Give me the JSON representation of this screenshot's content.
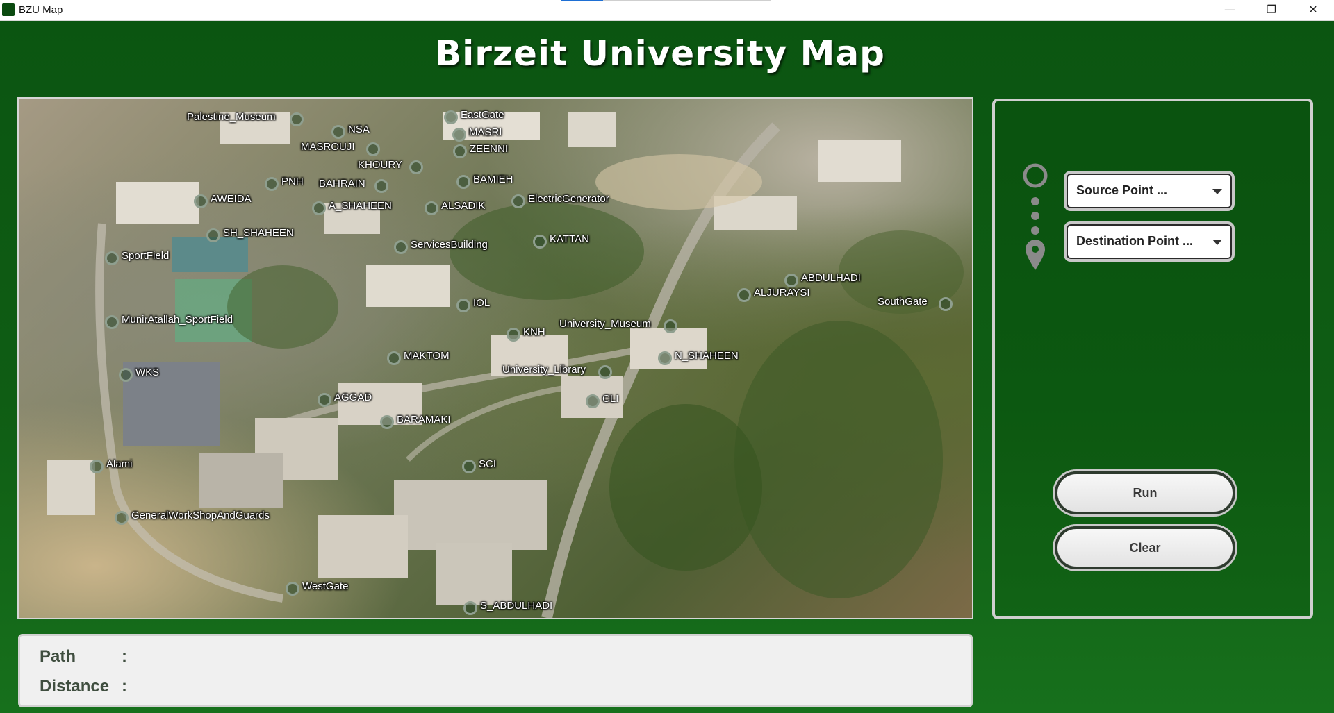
{
  "window": {
    "title": "BZU Map",
    "icon": "tree-icon",
    "controls": [
      "minimize-icon",
      "maximize-icon",
      "close-icon"
    ]
  },
  "app": {
    "title": "Birzeit University Map"
  },
  "map": {
    "image": "aerial-campus-photo",
    "locations": [
      "Palestine_Museum",
      "NSA",
      "EastGate",
      "MASRI",
      "MASROUJI",
      "ZEENNI",
      "KHOURY",
      "PNH",
      "BAHRAIN",
      "BAMIEH",
      "AWEIDA",
      "A_SHAHEEN",
      "ALSADIK",
      "ElectricGenerator",
      "SH_SHAHEEN",
      "ServicesBuilding",
      "KATTAN",
      "SportField",
      "ABDULHADI",
      "IOL",
      "ALJURAYSI",
      "SouthGate",
      "MunirAtallah_SportField",
      "University_Museum",
      "KNH",
      "MAKTOM",
      "N_SHAHEEN",
      "University_Library",
      "WKS",
      "AGGAD",
      "CLI",
      "BARAMAKI",
      "SCI",
      "Alami",
      "GeneralWorkShopAndGuards",
      "WestGate",
      "S_ABDULHADI"
    ]
  },
  "info": {
    "path_label": "Path",
    "distance_label": "Distance",
    "separator": ":",
    "path_value": "",
    "distance_value": ""
  },
  "controls": {
    "source_placeholder": "Source Point ...",
    "destination_placeholder": "Destination Point ...",
    "run_label": "Run",
    "clear_label": "Clear"
  },
  "colors": {
    "background": "#0d5a12",
    "pin": "#8f9f8f",
    "panel_border": "#cfcfcf"
  }
}
